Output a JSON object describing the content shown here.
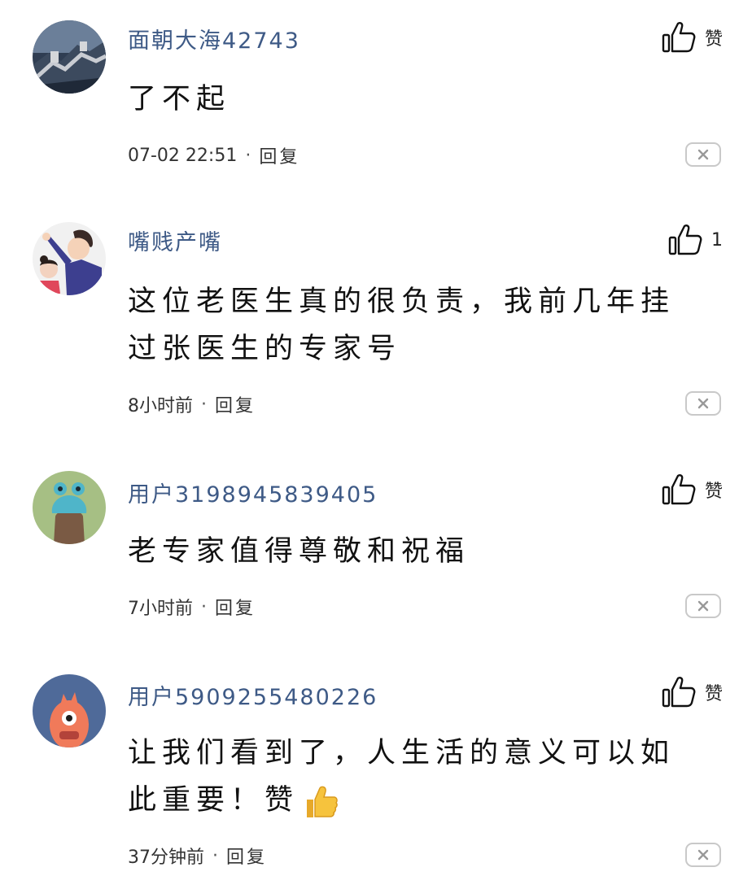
{
  "comments": [
    {
      "username": "面朝大海42743",
      "content": "了不起",
      "time": "07-02 22:51",
      "reply_label": "回复",
      "like_label": "赞",
      "avatar_icon": "great-wall-avatar"
    },
    {
      "username": "嘴贱产嘴",
      "content": "这位老医生真的很负责，我前几年挂过张医生的专家号",
      "time": "8小时前",
      "reply_label": "回复",
      "like_label": "1",
      "avatar_icon": "mother-child-avatar"
    },
    {
      "username": "用户3198945839405",
      "content": "老专家值得尊敬和祝福",
      "time": "7小时前",
      "reply_label": "回复",
      "like_label": "赞",
      "avatar_icon": "cartoon-creature-avatar"
    },
    {
      "username": "用户5909255480226",
      "content": "让我们看到了，人生活的意义可以如此重要！赞",
      "time": "37分钟前",
      "reply_label": "回复",
      "like_label": "赞",
      "avatar_icon": "cartoon-monster-avatar"
    }
  ],
  "meta_separator": "·",
  "colors": {
    "username": "#3e5a86",
    "text": "#111111",
    "border": "#c9c9c9"
  }
}
